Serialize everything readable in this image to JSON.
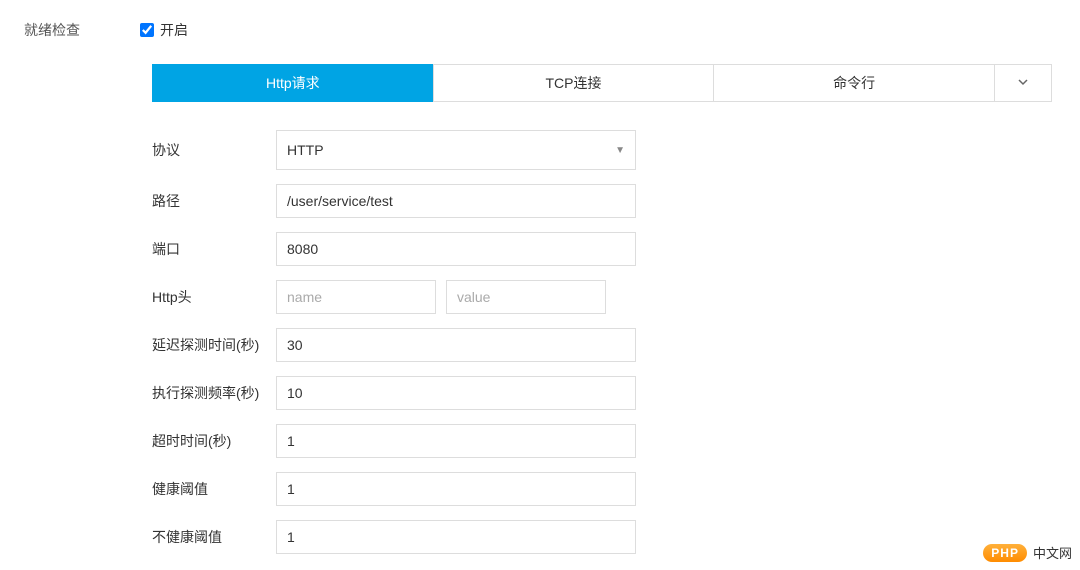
{
  "section_label": "就绪检查",
  "enable_label": "开启",
  "enable_checked": true,
  "tabs": {
    "http": "Http请求",
    "tcp": "TCP连接",
    "cmd": "命令行"
  },
  "fields": {
    "protocol": {
      "label": "协议",
      "value": "HTTP"
    },
    "path": {
      "label": "路径",
      "value": "/user/service/test"
    },
    "port": {
      "label": "端口",
      "value": "8080"
    },
    "http_header": {
      "label": "Http头",
      "name_placeholder": "name",
      "value_placeholder": "value"
    },
    "initial_delay": {
      "label": "延迟探测时间(秒)",
      "value": "30"
    },
    "period": {
      "label": "执行探测频率(秒)",
      "value": "10"
    },
    "timeout": {
      "label": "超时时间(秒)",
      "value": "1"
    },
    "healthy_threshold": {
      "label": "健康阈值",
      "value": "1"
    },
    "unhealthy_threshold": {
      "label": "不健康阈值",
      "value": "1"
    }
  },
  "watermark": {
    "badge": "PHP",
    "text": "中文网"
  }
}
